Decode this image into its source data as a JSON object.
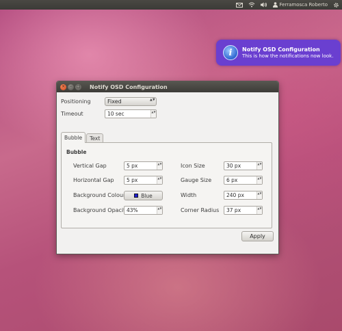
{
  "panel": {
    "user_name": "Ferramosca Roberto",
    "icons": [
      "mail-icon",
      "wifi-icon",
      "volume-icon",
      "user-icon",
      "gear-icon"
    ]
  },
  "notification": {
    "title": "Notify OSD Configuration",
    "body": "This is how the notifications now look.",
    "icon": "info-icon",
    "icon_glyph": "i",
    "background": "#6a3fd0"
  },
  "window": {
    "title": "Notify OSD Configuration",
    "close_glyph": "×",
    "min_glyph": "–",
    "max_glyph": "□",
    "positioning_label": "Positioning",
    "positioning_value": "Fixed",
    "timeout_label": "Timeout",
    "timeout_value": "10 sec",
    "tabs": [
      {
        "label": "Bubble",
        "active": true
      },
      {
        "label": "Text",
        "active": false
      }
    ],
    "bubble": {
      "section_title": "Bubble",
      "vertical_gap_label": "Vertical Gap",
      "vertical_gap_value": "5 px",
      "horizontal_gap_label": "Horizontal Gap",
      "horizontal_gap_value": "5 px",
      "background_colour_label": "Background Colour",
      "background_colour_value": "Blue",
      "background_colour_hex": "#1f1fd0",
      "background_opacity_label": "Background Opacity",
      "background_opacity_value": "43%",
      "icon_size_label": "Icon Size",
      "icon_size_value": "30 px",
      "gauge_size_label": "Gauge Size",
      "gauge_size_value": "6 px",
      "width_label": "Width",
      "width_value": "240 px",
      "corner_radius_label": "Corner Radius",
      "corner_radius_value": "37 px"
    },
    "apply_label": "Apply"
  },
  "spin_arrows": "▲▼",
  "combo_arrows": "▲▼"
}
